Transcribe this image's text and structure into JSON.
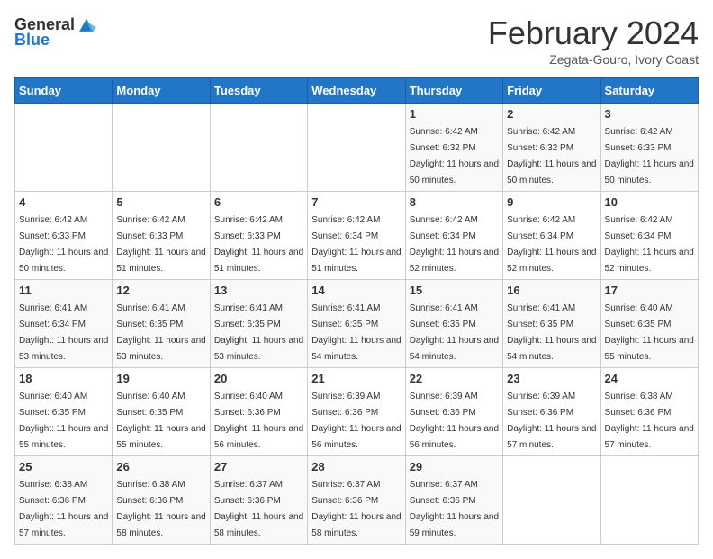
{
  "header": {
    "logo_general": "General",
    "logo_blue": "Blue",
    "month_title": "February 2024",
    "subtitle": "Zegata-Gouro, Ivory Coast"
  },
  "days_of_week": [
    "Sunday",
    "Monday",
    "Tuesday",
    "Wednesday",
    "Thursday",
    "Friday",
    "Saturday"
  ],
  "weeks": [
    [
      {
        "day": "",
        "sunrise": "",
        "sunset": "",
        "daylight": ""
      },
      {
        "day": "",
        "sunrise": "",
        "sunset": "",
        "daylight": ""
      },
      {
        "day": "",
        "sunrise": "",
        "sunset": "",
        "daylight": ""
      },
      {
        "day": "",
        "sunrise": "",
        "sunset": "",
        "daylight": ""
      },
      {
        "day": "1",
        "sunrise": "Sunrise: 6:42 AM",
        "sunset": "Sunset: 6:32 PM",
        "daylight": "Daylight: 11 hours and 50 minutes."
      },
      {
        "day": "2",
        "sunrise": "Sunrise: 6:42 AM",
        "sunset": "Sunset: 6:32 PM",
        "daylight": "Daylight: 11 hours and 50 minutes."
      },
      {
        "day": "3",
        "sunrise": "Sunrise: 6:42 AM",
        "sunset": "Sunset: 6:33 PM",
        "daylight": "Daylight: 11 hours and 50 minutes."
      }
    ],
    [
      {
        "day": "4",
        "sunrise": "Sunrise: 6:42 AM",
        "sunset": "Sunset: 6:33 PM",
        "daylight": "Daylight: 11 hours and 50 minutes."
      },
      {
        "day": "5",
        "sunrise": "Sunrise: 6:42 AM",
        "sunset": "Sunset: 6:33 PM",
        "daylight": "Daylight: 11 hours and 51 minutes."
      },
      {
        "day": "6",
        "sunrise": "Sunrise: 6:42 AM",
        "sunset": "Sunset: 6:33 PM",
        "daylight": "Daylight: 11 hours and 51 minutes."
      },
      {
        "day": "7",
        "sunrise": "Sunrise: 6:42 AM",
        "sunset": "Sunset: 6:34 PM",
        "daylight": "Daylight: 11 hours and 51 minutes."
      },
      {
        "day": "8",
        "sunrise": "Sunrise: 6:42 AM",
        "sunset": "Sunset: 6:34 PM",
        "daylight": "Daylight: 11 hours and 52 minutes."
      },
      {
        "day": "9",
        "sunrise": "Sunrise: 6:42 AM",
        "sunset": "Sunset: 6:34 PM",
        "daylight": "Daylight: 11 hours and 52 minutes."
      },
      {
        "day": "10",
        "sunrise": "Sunrise: 6:42 AM",
        "sunset": "Sunset: 6:34 PM",
        "daylight": "Daylight: 11 hours and 52 minutes."
      }
    ],
    [
      {
        "day": "11",
        "sunrise": "Sunrise: 6:41 AM",
        "sunset": "Sunset: 6:34 PM",
        "daylight": "Daylight: 11 hours and 53 minutes."
      },
      {
        "day": "12",
        "sunrise": "Sunrise: 6:41 AM",
        "sunset": "Sunset: 6:35 PM",
        "daylight": "Daylight: 11 hours and 53 minutes."
      },
      {
        "day": "13",
        "sunrise": "Sunrise: 6:41 AM",
        "sunset": "Sunset: 6:35 PM",
        "daylight": "Daylight: 11 hours and 53 minutes."
      },
      {
        "day": "14",
        "sunrise": "Sunrise: 6:41 AM",
        "sunset": "Sunset: 6:35 PM",
        "daylight": "Daylight: 11 hours and 54 minutes."
      },
      {
        "day": "15",
        "sunrise": "Sunrise: 6:41 AM",
        "sunset": "Sunset: 6:35 PM",
        "daylight": "Daylight: 11 hours and 54 minutes."
      },
      {
        "day": "16",
        "sunrise": "Sunrise: 6:41 AM",
        "sunset": "Sunset: 6:35 PM",
        "daylight": "Daylight: 11 hours and 54 minutes."
      },
      {
        "day": "17",
        "sunrise": "Sunrise: 6:40 AM",
        "sunset": "Sunset: 6:35 PM",
        "daylight": "Daylight: 11 hours and 55 minutes."
      }
    ],
    [
      {
        "day": "18",
        "sunrise": "Sunrise: 6:40 AM",
        "sunset": "Sunset: 6:35 PM",
        "daylight": "Daylight: 11 hours and 55 minutes."
      },
      {
        "day": "19",
        "sunrise": "Sunrise: 6:40 AM",
        "sunset": "Sunset: 6:35 PM",
        "daylight": "Daylight: 11 hours and 55 minutes."
      },
      {
        "day": "20",
        "sunrise": "Sunrise: 6:40 AM",
        "sunset": "Sunset: 6:36 PM",
        "daylight": "Daylight: 11 hours and 56 minutes."
      },
      {
        "day": "21",
        "sunrise": "Sunrise: 6:39 AM",
        "sunset": "Sunset: 6:36 PM",
        "daylight": "Daylight: 11 hours and 56 minutes."
      },
      {
        "day": "22",
        "sunrise": "Sunrise: 6:39 AM",
        "sunset": "Sunset: 6:36 PM",
        "daylight": "Daylight: 11 hours and 56 minutes."
      },
      {
        "day": "23",
        "sunrise": "Sunrise: 6:39 AM",
        "sunset": "Sunset: 6:36 PM",
        "daylight": "Daylight: 11 hours and 57 minutes."
      },
      {
        "day": "24",
        "sunrise": "Sunrise: 6:38 AM",
        "sunset": "Sunset: 6:36 PM",
        "daylight": "Daylight: 11 hours and 57 minutes."
      }
    ],
    [
      {
        "day": "25",
        "sunrise": "Sunrise: 6:38 AM",
        "sunset": "Sunset: 6:36 PM",
        "daylight": "Daylight: 11 hours and 57 minutes."
      },
      {
        "day": "26",
        "sunrise": "Sunrise: 6:38 AM",
        "sunset": "Sunset: 6:36 PM",
        "daylight": "Daylight: 11 hours and 58 minutes."
      },
      {
        "day": "27",
        "sunrise": "Sunrise: 6:37 AM",
        "sunset": "Sunset: 6:36 PM",
        "daylight": "Daylight: 11 hours and 58 minutes."
      },
      {
        "day": "28",
        "sunrise": "Sunrise: 6:37 AM",
        "sunset": "Sunset: 6:36 PM",
        "daylight": "Daylight: 11 hours and 58 minutes."
      },
      {
        "day": "29",
        "sunrise": "Sunrise: 6:37 AM",
        "sunset": "Sunset: 6:36 PM",
        "daylight": "Daylight: 11 hours and 59 minutes."
      },
      {
        "day": "",
        "sunrise": "",
        "sunset": "",
        "daylight": ""
      },
      {
        "day": "",
        "sunrise": "",
        "sunset": "",
        "daylight": ""
      }
    ]
  ]
}
